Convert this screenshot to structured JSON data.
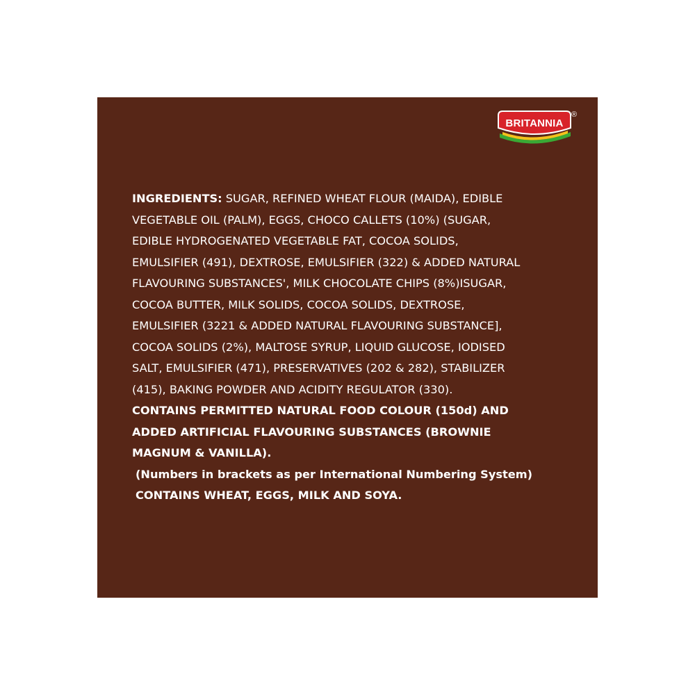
{
  "brand": {
    "logo_text": "BRITANNIA",
    "registered_mark": "®",
    "colors": {
      "panel": "#572617",
      "logo_red": "#d8232a",
      "logo_green": "#3aa935",
      "logo_yellow": "#f4c11c",
      "text": "#ffffff"
    }
  },
  "ingredients": {
    "heading": "INGREDIENTS:",
    "lines": [
      " SUGAR, REFINED WHEAT FLOUR (MAIDA), EDIBLE",
      "VEGETABLE OIL (PALM), EGGS, CHOCO CALLETS (10%) (SUGAR,",
      "EDIBLE HYDROGENATED VEGETABLE FAT, COCOA SOLIDS,",
      "EMULSIFIER (491), DEXTROSE, EMULSIFIER (322) & ADDED NATURAL",
      "FLAVOURING SUBSTANCES', MILK CHOCOLATE CHIPS (8%)ISUGAR,",
      "COCOA BUTTER, MILK SOLIDS, COCOA SOLIDS, DEXTROSE,",
      "EMULSIFIER (3221 & ADDED NATURAL FLAVOURING SUBSTANCE],",
      "COCOA SOLIDS (2%), MALTOSE SYRUP, LIQUID GLUCOSE, IODISED",
      "SALT, EMULSIFIER (471), PRESERVATIVES (202 & 282), STABILIZER",
      "(415), BAKING POWDER AND ACIDITY REGULATOR (330)."
    ],
    "contains_colour_lines": [
      "CONTAINS PERMITTED NATURAL FOOD COLOUR (150d) AND",
      "ADDED ARTIFICIAL FLAVOURING SUBSTANCES (BROWNIE",
      "MAGNUM & VANILLA)."
    ],
    "ins_note": "(Numbers in brackets as per International Numbering System)",
    "allergens": "CONTAINS WHEAT, EGGS, MILK AND SOYA."
  }
}
